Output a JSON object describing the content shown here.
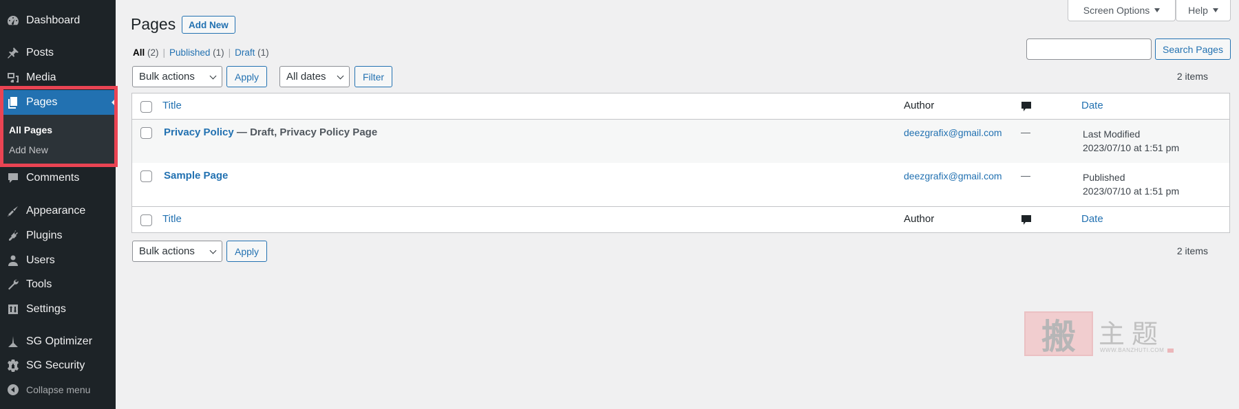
{
  "sidebar": {
    "items": [
      {
        "label": "Dashboard",
        "icon": "dashboard-icon"
      },
      {
        "label": "Posts",
        "icon": "pin-icon"
      },
      {
        "label": "Media",
        "icon": "media-icon"
      },
      {
        "label": "Pages",
        "icon": "pages-icon",
        "current": true
      },
      {
        "label": "Comments",
        "icon": "comment-icon"
      },
      {
        "label": "Appearance",
        "icon": "brush-icon"
      },
      {
        "label": "Plugins",
        "icon": "plug-icon"
      },
      {
        "label": "Users",
        "icon": "user-icon"
      },
      {
        "label": "Tools",
        "icon": "wrench-icon"
      },
      {
        "label": "Settings",
        "icon": "settings-icon"
      },
      {
        "label": "SG Optimizer",
        "icon": "sg-optimizer-icon"
      },
      {
        "label": "SG Security",
        "icon": "sg-security-icon"
      }
    ],
    "submenu": [
      "All Pages",
      "Add New"
    ],
    "collapse_label": "Collapse menu"
  },
  "header": {
    "screen_options": "Screen Options",
    "help": "Help",
    "title": "Pages",
    "add_new": "Add New"
  },
  "filters": {
    "all": "All",
    "all_count": "(2)",
    "published": "Published",
    "published_count": "(1)",
    "draft": "Draft",
    "draft_count": "(1)",
    "separator": "|"
  },
  "search": {
    "value": "",
    "button": "Search Pages"
  },
  "tablenav": {
    "bulk_actions": "Bulk actions",
    "apply": "Apply",
    "all_dates": "All dates",
    "filter": "Filter",
    "items_count": "2 items"
  },
  "table": {
    "columns": {
      "title": "Title",
      "author": "Author",
      "comments_icon": "comment-bubble-icon",
      "date": "Date"
    },
    "rows": [
      {
        "title": "Privacy Policy",
        "state": " — Draft, Privacy Policy Page",
        "author": "deezgrafix@gmail.com",
        "comments": "—",
        "date_status": "Last Modified",
        "date": "2023/07/10 at 1:51 pm"
      },
      {
        "title": "Sample Page",
        "state": "",
        "author": "deezgrafix@gmail.com",
        "comments": "—",
        "date_status": "Published",
        "date": "2023/07/10 at 1:51 pm"
      }
    ]
  },
  "watermark": {
    "stamp": "搬",
    "chars": "主题",
    "url": "WWW.BANZHUTI.COM"
  },
  "colors": {
    "accent": "#2271b1",
    "sidebar": "#1d2327",
    "highlight": "#ea4453"
  }
}
